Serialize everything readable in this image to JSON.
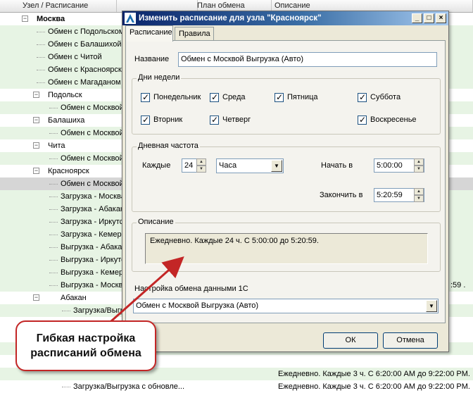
{
  "grid": {
    "headers": [
      "Узел / Расписание",
      "План обмена",
      "Описание"
    ],
    "rows": [
      {
        "label": "Москва",
        "bold": true,
        "expander": "−",
        "bg": "white",
        "desc": ""
      },
      {
        "label": "Обмен с Подольском",
        "bg": "green",
        "desc": ""
      },
      {
        "label": "Обмен с Балашихой",
        "bg": "green",
        "desc": ""
      },
      {
        "label": "Обмен с Читой",
        "bg": "green",
        "desc": ""
      },
      {
        "label": "Обмен с Красноярском",
        "bg": "green",
        "desc": ""
      },
      {
        "label": "Обмен с Магаданом",
        "bg": "green",
        "desc": ""
      },
      {
        "label": "Подольск",
        "expander": "−",
        "bg": "white",
        "desc": ""
      },
      {
        "label": "Обмен с Москвой",
        "bg": "green",
        "desc": ""
      },
      {
        "label": "Балашиха",
        "expander": "−",
        "bg": "white",
        "desc": ""
      },
      {
        "label": "Обмен с Москвой",
        "bg": "green",
        "desc": ""
      },
      {
        "label": "Чита",
        "expander": "−",
        "bg": "white",
        "desc": ""
      },
      {
        "label": "Обмен с Москвой",
        "bg": "green",
        "desc": ""
      },
      {
        "label": "Красноярск",
        "expander": "−",
        "bg": "white",
        "desc": ""
      },
      {
        "label": "Обмен с Москвой",
        "bg": "sel",
        "desc": ""
      },
      {
        "label": "Загрузка - Москва",
        "bg": "green",
        "desc": ""
      },
      {
        "label": "Загрузка - Абакан",
        "bg": "green",
        "desc": ""
      },
      {
        "label": "Загрузка - Иркутск",
        "bg": "green",
        "desc": ""
      },
      {
        "label": "Загрузка - Кемерово",
        "bg": "green",
        "desc": ""
      },
      {
        "label": "Выгрузка - Абакан",
        "bg": "green",
        "desc": ""
      },
      {
        "label": "Выгрузка - Иркутск",
        "bg": "green",
        "desc": ""
      },
      {
        "label": "Выгрузка - Кемерово",
        "bg": "green",
        "desc": ""
      },
      {
        "label": "Выгрузка - Москва",
        "bg": "green",
        "desc": ":59 ."
      },
      {
        "label": "Абакан",
        "expander": "−",
        "bg": "white",
        "desc": ""
      },
      {
        "label": "Загрузка/Выгрузка",
        "bg": "green",
        "desc": ""
      },
      {
        "label": "",
        "bg": "white",
        "desc": ""
      },
      {
        "label": "",
        "bg": "white",
        "desc": ""
      },
      {
        "label": "",
        "bg": "green",
        "desc": ""
      },
      {
        "label": "",
        "bg": "white",
        "desc": ""
      },
      {
        "label": "",
        "bg": "green",
        "desc": "Ежедневно. Каждые 3 ч.  С 6:20:00 AM до 9:22:00 PM."
      },
      {
        "label": "Загрузка/Выгрузка с обновле...",
        "bg": "white",
        "desc": "Ежедневно. Каждые 3 ч.  С 6:20:00 AM до 9:22:00 PM."
      }
    ]
  },
  "dialog": {
    "title": "Изменить расписание для узла \"Красноярск\"",
    "buttons": {
      "minimize": "_",
      "maximize": "□",
      "close": "×"
    },
    "tabs": [
      "Расписание",
      "Правила"
    ],
    "name_label": "Название",
    "name_value": "Обмен с Москвой Выгрузка (Авто)",
    "days_group": "Дни недели",
    "days": [
      {
        "label": "Понедельник",
        "checked": true
      },
      {
        "label": "Среда",
        "checked": true
      },
      {
        "label": "Пятница",
        "checked": true
      },
      {
        "label": "Суббота",
        "checked": true
      },
      {
        "label": "Вторник",
        "checked": true
      },
      {
        "label": "Четверг",
        "checked": true
      },
      {
        "label": "Воскресенье",
        "checked": true
      }
    ],
    "freq_group": "Дневная частота",
    "every_label": "Каждые",
    "every_value": "24",
    "unit_value": "Часа",
    "start_label": "Начать в",
    "start_value": "5:00:00",
    "end_label": "Закончить в",
    "end_value": "5:20:59",
    "desc_group": "Описание",
    "desc_text": "Ежедневно. Каждые 24 ч.  С 5:00:00 до 5:20:59.",
    "setting_label": "Настройка обмена данными 1С",
    "setting_value": "Обмен с Москвой Выгрузка (Авто)",
    "ok": "ОК",
    "cancel": "Отмена"
  },
  "callout": {
    "line1": "Гибкая настройка",
    "line2": "расписаний обмена",
    "color": "#c32626"
  }
}
